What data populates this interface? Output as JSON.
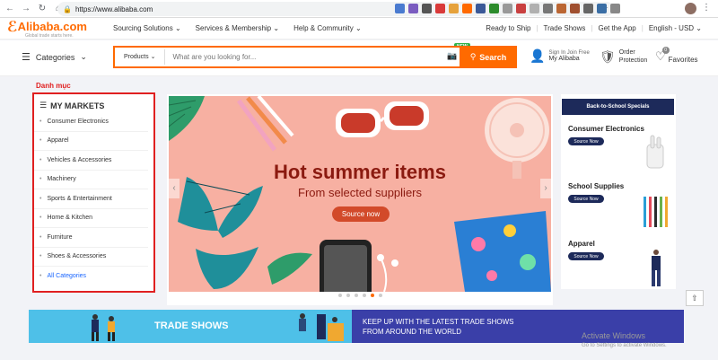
{
  "browser": {
    "url": "https://www.alibaba.com"
  },
  "header": {
    "logo_text": "Alibaba.com",
    "logo_tagline": "Global trade starts here.",
    "nav_links": [
      "Sourcing Solutions",
      "Services & Membership",
      "Help & Community"
    ],
    "right_links": [
      "Ready to Ship",
      "Trade Shows",
      "Get the App",
      "English - USD"
    ]
  },
  "search": {
    "categories_label": "Categories",
    "dropdown_label": "Products",
    "placeholder": "What are you looking for...",
    "button_label": "Search",
    "new_badge": "NEW"
  },
  "account": {
    "sign_in_line": "Sign In  Join Free",
    "my_alibaba": "My Alibaba",
    "order_label": "Order Protection",
    "favorites_label": "Favorites",
    "favorites_count": "0"
  },
  "annotation": {
    "label": "Danh mục",
    "color": "#e02020"
  },
  "markets": {
    "title": "MY MARKETS",
    "items": [
      "Consumer Electronics",
      "Apparel",
      "Vehicles & Accessories",
      "Machinery",
      "Sports & Entertainment",
      "Home & Kitchen",
      "Furniture",
      "Shoes & Accessories",
      "All Categories"
    ]
  },
  "banner": {
    "title": "Hot summer items",
    "subtitle": "From selected suppliers",
    "button": "Source now",
    "slides": 6,
    "active_slide": 5
  },
  "specials": {
    "header": "Back-to-School Specials",
    "items": [
      {
        "title": "Consumer Electronics",
        "button": "Source Now"
      },
      {
        "title": "School Supplies",
        "button": "Source Now"
      },
      {
        "title": "Apparel",
        "button": "Source Now"
      }
    ]
  },
  "trade_shows": {
    "title": "TRADE SHOWS",
    "subtitle_line1": "KEEP UP WITH THE LATEST TRADE SHOWS",
    "subtitle_line2": "FROM AROUND THE WORLD"
  },
  "windows": {
    "line1": "Activate Windows",
    "line2": "Go to Settings to activate Windows."
  },
  "colors": {
    "brand": "#ff6a00",
    "navy": "#1d2a5a",
    "banner_bg": "#f7b0a2"
  }
}
